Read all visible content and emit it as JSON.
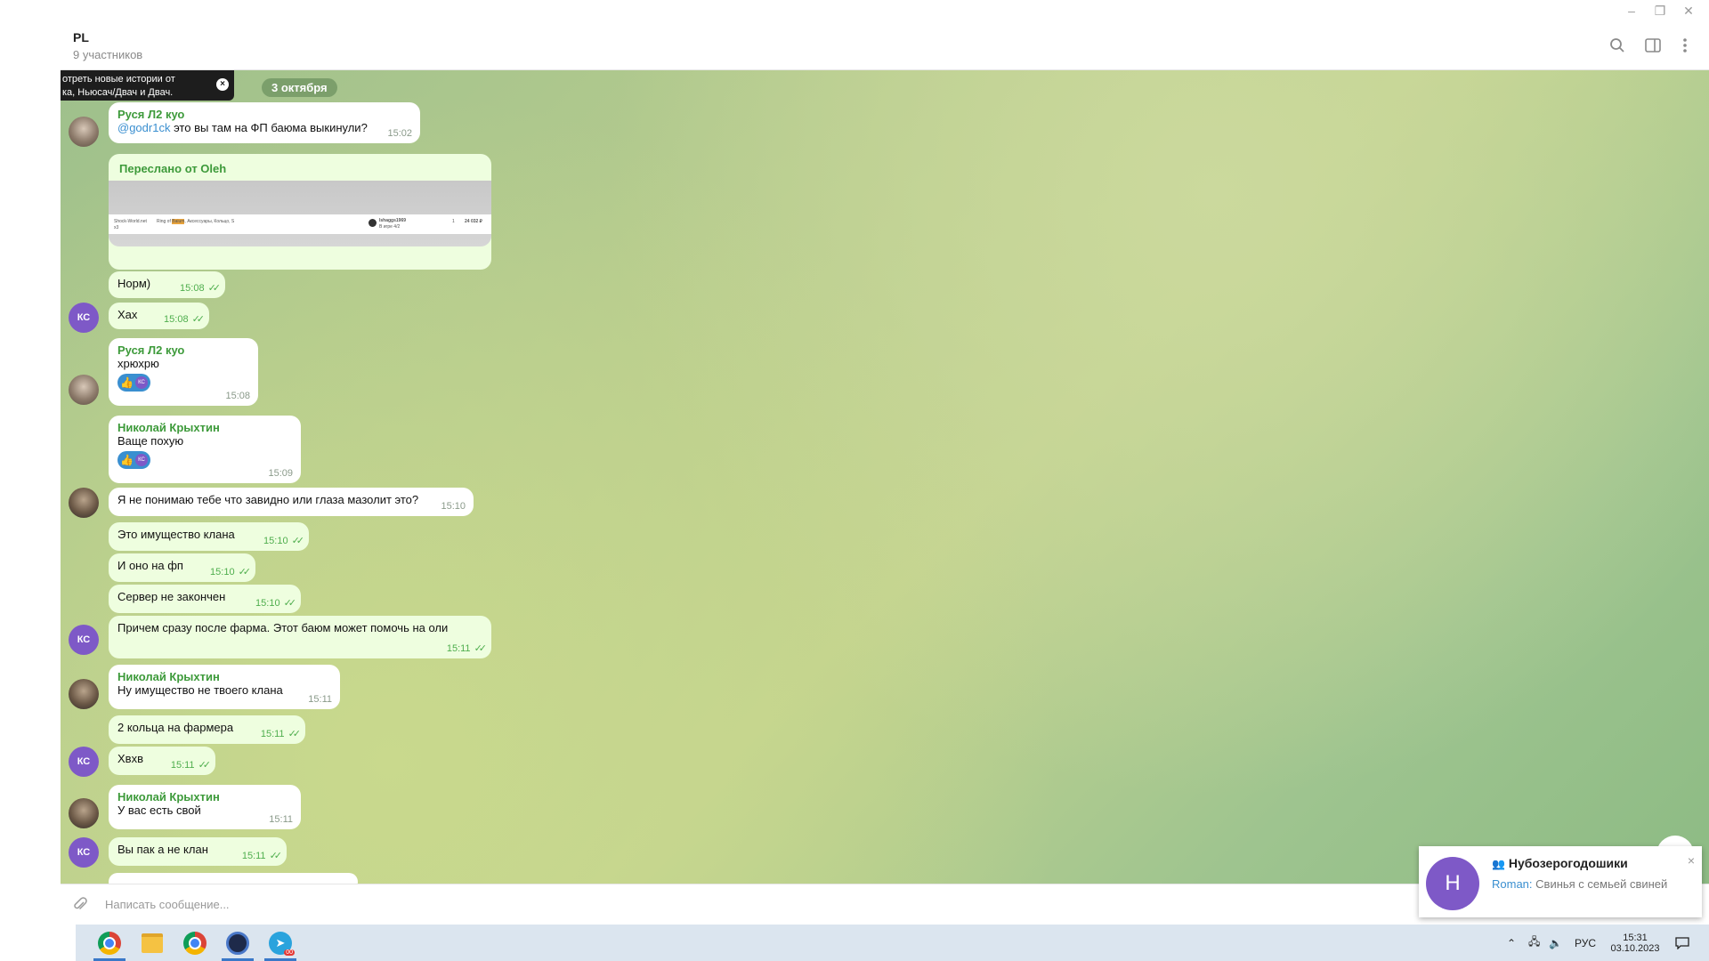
{
  "window": {
    "minimize": "–",
    "restore": "❐",
    "close": "✕"
  },
  "header": {
    "title": "PL",
    "subtitle": "9 участников"
  },
  "tooltip": {
    "line1": "отреть новые истории от",
    "line2": "ка, Ньюсач/Двач и Двач.",
    "close": "×"
  },
  "date_separator": "3 октября",
  "messages": [
    {
      "sender": "Руся Л2 куо",
      "mention": "@godr1ck",
      "text": " это вы там на ФП баюма выкинули?",
      "time": "15:02"
    },
    {
      "forward_from": "Переслано от Oleh"
    },
    {
      "text": "Норм)",
      "time": "15:08"
    },
    {
      "text": "Хах",
      "time": "15:08"
    },
    {
      "sender": "Руся Л2 куо",
      "text": "хрюхрю",
      "time": "15:08"
    },
    {
      "sender": "Николай Крыхтин",
      "text": "Ваще похую",
      "time": "15:09"
    },
    {
      "text": "Я не понимаю тебе что завидно или глаза мазолит это?",
      "time": "15:10"
    },
    {
      "text": "Это имущество клана",
      "time": "15:10"
    },
    {
      "text": "И оно на фп",
      "time": "15:10"
    },
    {
      "text": "Сервер не закончен",
      "time": "15:10"
    },
    {
      "text": "Причем сразу после фарма. Этот баюм может помочь на оли",
      "time": "15:11"
    },
    {
      "sender": "Николай Крыхтин",
      "text": "Ну имущество не твоего клана",
      "time": "15:11"
    },
    {
      "text": "2 кольца на фармера",
      "time": "15:11"
    },
    {
      "text": "Хвхв",
      "time": "15:11"
    },
    {
      "sender": "Николай Крыхтин",
      "text": "У вас есть свой",
      "time": "15:11"
    },
    {
      "text": "Вы пак а не клан",
      "time": "15:11"
    }
  ],
  "avatar_initials": "КС",
  "reaction_emoji": "👍",
  "reaction_initials": "КС",
  "forward_preview": {
    "col1": "Shock-World.net",
    "col1b": "x3",
    "col2": "Ring of",
    "col2_hl": "Baium",
    "col2b": ", Аксессуары, Кольцо, S",
    "user": "Ishaggs1969",
    "user_meta": "В игре 4/2",
    "qty": "1",
    "price": "24 032 ₽"
  },
  "composer": {
    "placeholder": "Написать сообщение..."
  },
  "toast": {
    "avatar": "Н",
    "title": "Нубозерогодошики",
    "sender": "Roman:",
    "message": " Свинья с семьей свиней",
    "close": "×"
  },
  "taskbar": {
    "lang": "РУС",
    "time": "15:31",
    "date": "03.10.2023",
    "telegram_badge": "00"
  }
}
